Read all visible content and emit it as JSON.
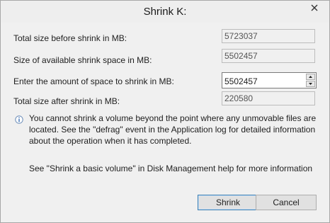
{
  "window": {
    "title": "Shrink K:"
  },
  "fields": {
    "total_before": {
      "label": "Total size before shrink in MB:",
      "value": "5723037"
    },
    "available": {
      "label": "Size of available shrink space in MB:",
      "value": "5502457"
    },
    "amount": {
      "label": "Enter the amount of space to shrink in MB:",
      "value": "5502457"
    },
    "total_after": {
      "label": "Total size after shrink in MB:",
      "value": "220580"
    }
  },
  "info": {
    "icon": "info-icon",
    "text": "You cannot shrink a volume beyond the point where any unmovable files are located. See the \"defrag\" event in the Application log for detailed information about the operation when it has completed."
  },
  "help": {
    "text": "See \"Shrink a basic volume\" in Disk Management help for more information"
  },
  "buttons": {
    "shrink": "Shrink",
    "cancel": "Cancel"
  }
}
